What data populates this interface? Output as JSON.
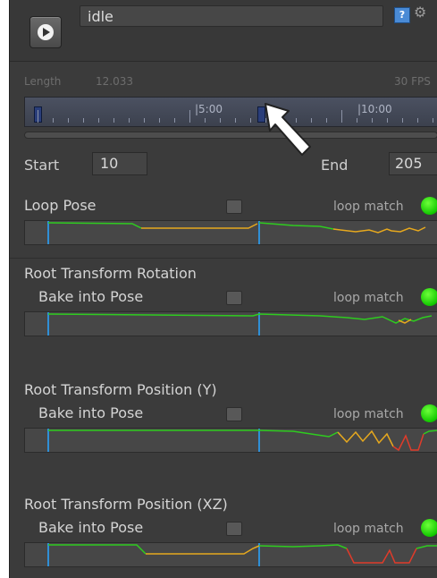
{
  "clip": {
    "name": "idle",
    "length_label": "Length",
    "length_value": "12.033",
    "fps_label": "30 FPS",
    "icons": {
      "play": "play-icon",
      "help": "help-icon",
      "settings": "gear-icon"
    }
  },
  "timeline": {
    "tick_labels": [
      "|5:00",
      "|10:00"
    ],
    "markers": [
      "start-marker",
      "playhead-marker"
    ]
  },
  "range": {
    "start_label": "Start",
    "start_value": "10",
    "end_label": "End",
    "end_value": "205"
  },
  "sections": [
    {
      "title": "Loop Pose",
      "loop_match": "loop match",
      "status": "green"
    },
    {
      "title": "Root Transform Rotation",
      "bake_label": "Bake into Pose",
      "loop_match": "loop match",
      "status": "green"
    },
    {
      "title": "Root Transform Position (Y)",
      "bake_label": "Bake into Pose",
      "loop_match": "loop match",
      "status": "green"
    },
    {
      "title": "Root Transform Position (XZ)",
      "bake_label": "Bake into Pose",
      "loop_match": "loop match",
      "status": "green"
    }
  ],
  "colors": {
    "match_good": "#2ecc1f",
    "match_mid": "#e6a81e",
    "match_bad": "#e03b2a",
    "marker_line": "#2f8fd6"
  }
}
